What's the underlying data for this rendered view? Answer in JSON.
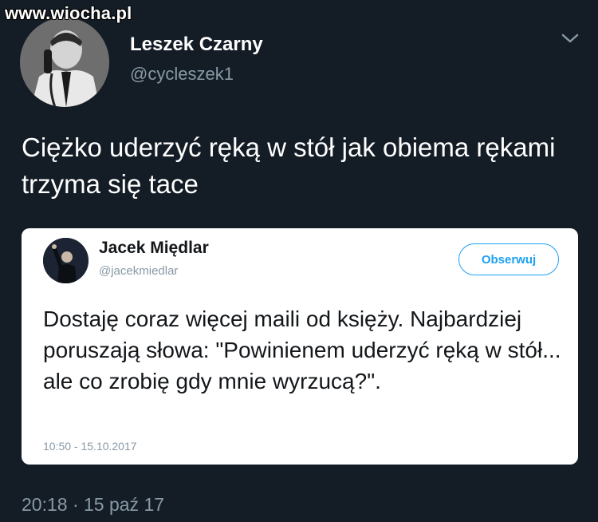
{
  "watermark": "www.wiocha.pl",
  "tweet": {
    "author_name": "Leszek Czarny",
    "author_handle": "@cycleszek1",
    "text": "Ciężko uderzyć ręką w stół jak obiema rękami trzyma się tace",
    "timestamp": "20:18 · 15 paź 17"
  },
  "quoted_tweet": {
    "author_name": "Jacek Międlar",
    "author_handle": "@jacekmiedlar",
    "follow_label": "Obserwuj",
    "text": "Dostaję coraz więcej maili od księży. Najbardziej poruszają słowa: \"Powinienem uderzyć ręką w stół... ale co zrobię gdy mnie wyrzucą?\".",
    "timestamp": "10:50 - 15.10.2017"
  },
  "icons": {
    "menu": "chevron-down-icon"
  },
  "colors": {
    "background": "#141d26",
    "secondary_text": "#8899a6",
    "accent": "#1da1f2",
    "card": "#ffffff"
  }
}
